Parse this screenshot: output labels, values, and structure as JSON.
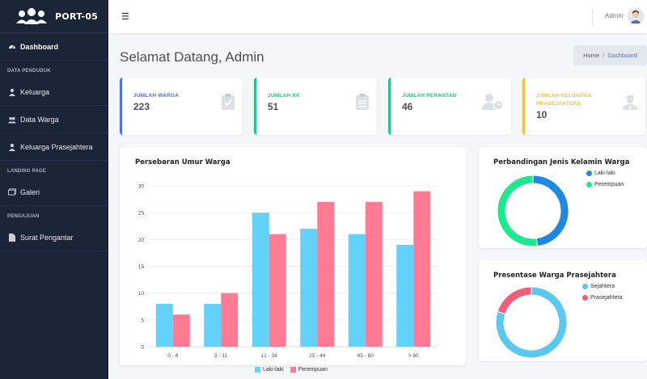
{
  "brand": {
    "name": "PORT-05"
  },
  "sidebar": {
    "dashboard": "Dashboard",
    "section_penduduk": "DATA PENDUDUK",
    "keluarga": "Keluarga",
    "data_warga": "Data Warga",
    "keluarga_prasejahtera": "Keluarga Prasejahtera",
    "section_landing": "LANDING PAGE",
    "galeri": "Galeri",
    "section_pengajuan": "PENGAJUAN",
    "surat_pengantar": "Surat Pengantar"
  },
  "topbar": {
    "user_name": "Admin"
  },
  "header": {
    "title": "Selamat Datang, Admin",
    "breadcrumb_home": "Home",
    "breadcrumb_sep": "/",
    "breadcrumb_current": "Dashboard"
  },
  "cards": [
    {
      "label": "JUMLAH WARGA",
      "value": "223",
      "color": "#4e73df",
      "icon": "clipboard-check-icon"
    },
    {
      "label": "JUMLAH KK",
      "value": "51",
      "color": "#1cc88a",
      "icon": "clipboard-list-icon"
    },
    {
      "label": "JUMLAH PERANTAU",
      "value": "46",
      "color": "#1cc88a",
      "icon": "user-clock-icon"
    },
    {
      "label": "JUMLAH KELUARGA PRASEJAHTERA",
      "value": "10",
      "color": "#f6c23e",
      "icon": "user-nurse-icon"
    }
  ],
  "chart_data": [
    {
      "type": "bar",
      "title": "Persebaran Umur Warga",
      "categories": [
        "0 - 4",
        "5 - 11",
        "12 - 24",
        "25 - 44",
        "45 - 60",
        "> 60"
      ],
      "series": [
        {
          "name": "Laki-laki",
          "values": [
            8,
            8,
            25,
            22,
            21,
            19
          ],
          "color": "#63d2fb"
        },
        {
          "name": "Perempuan",
          "values": [
            6,
            10,
            21,
            27,
            27,
            29
          ],
          "color": "#ff7a93"
        }
      ],
      "ylim": [
        0,
        30
      ],
      "yticks": [
        "0",
        "5",
        "10",
        "15",
        "20",
        "25",
        "30"
      ],
      "legend": "bottom"
    },
    {
      "type": "pie",
      "title": "Perbandingan Jenis Kelamin Warga",
      "labels": [
        "Laki-laki",
        "Perempuan"
      ],
      "values": [
        48,
        52
      ],
      "colors": [
        "#1e88e5",
        "#1de88f"
      ],
      "legend": "top-right"
    },
    {
      "type": "pie",
      "title": "Presentase Warga Prasejahtera",
      "labels": [
        "Sejahtera",
        "Prasejahtera"
      ],
      "values": [
        80,
        20
      ],
      "colors": [
        "#5bc8f0",
        "#f25d7a"
      ],
      "legend": "top-right"
    }
  ]
}
